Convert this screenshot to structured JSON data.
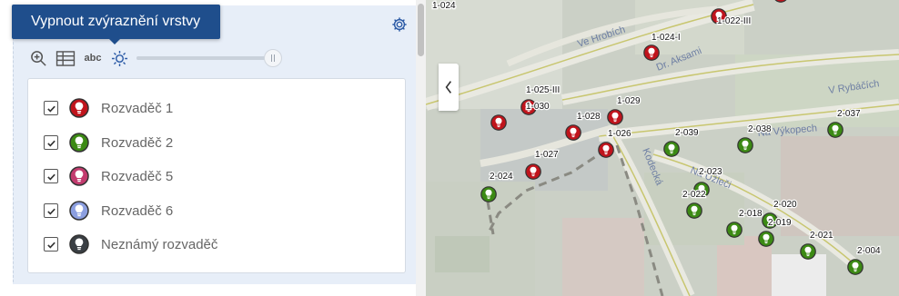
{
  "tooltip": {
    "text": "Vypnout zvýraznění vrstvy"
  },
  "toolbar": {
    "abc_label": "abc"
  },
  "opacity_slider": {
    "value_fraction": 1.0
  },
  "legend": {
    "items": [
      {
        "label": "Rozvaděč 1",
        "checked": true,
        "color": "#c0141c",
        "icon": "red-pin-icon"
      },
      {
        "label": "Rozvaděč 2",
        "checked": true,
        "color": "#3c8a14",
        "icon": "green-pin-icon"
      },
      {
        "label": "Rozvaděč 5",
        "checked": true,
        "color": "#c23b6e",
        "icon": "pink-pin-icon"
      },
      {
        "label": "Rozvaděč 6",
        "checked": true,
        "color": "#8c9fe0",
        "icon": "blue-pin-icon"
      },
      {
        "label": "Neznámý rozvaděč",
        "checked": true,
        "color": "#3a3f44",
        "icon": "dark-pin-icon"
      }
    ]
  },
  "map": {
    "road_labels": [
      "Ve Hrobích",
      "Dr. Aksami",
      "V Rybáčích",
      "Na Výkopech",
      "Kodecká",
      "Na Úžleči"
    ],
    "markers": [
      {
        "label": "1-024",
        "type": "red"
      },
      {
        "label": "1-022-III",
        "type": "red"
      },
      {
        "label": "1-024-I",
        "type": "red"
      },
      {
        "label": "1-025-III",
        "type": "red"
      },
      {
        "label": "1-030",
        "type": "red"
      },
      {
        "label": "1-029",
        "type": "red"
      },
      {
        "label": "1-028",
        "type": "red"
      },
      {
        "label": "1-026",
        "type": "red"
      },
      {
        "label": "1-027",
        "type": "red"
      },
      {
        "label": "2-024",
        "type": "green"
      },
      {
        "label": "2-039",
        "type": "green"
      },
      {
        "label": "2-038",
        "type": "green"
      },
      {
        "label": "2-037",
        "type": "green"
      },
      {
        "label": "2-023",
        "type": "green"
      },
      {
        "label": "2-022",
        "type": "green"
      },
      {
        "label": "2-020",
        "type": "green"
      },
      {
        "label": "2-018",
        "type": "green"
      },
      {
        "label": "2-019",
        "type": "green"
      },
      {
        "label": "2-021",
        "type": "green"
      },
      {
        "label": "2-004",
        "type": "green"
      }
    ]
  }
}
